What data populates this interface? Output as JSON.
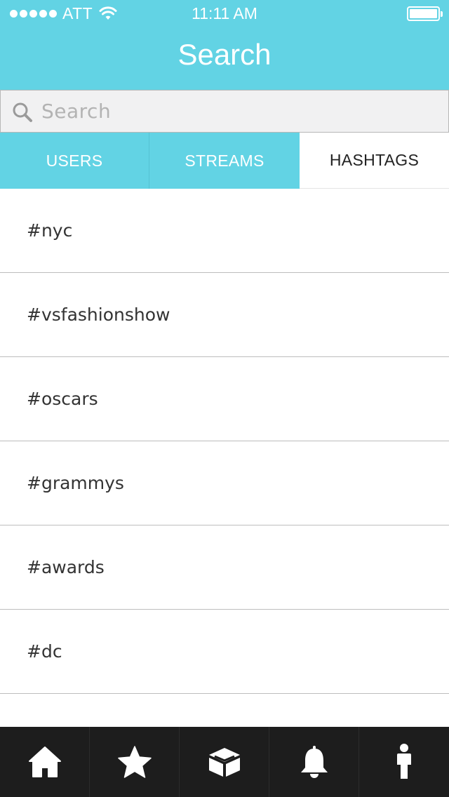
{
  "status_bar": {
    "carrier": "ATT",
    "time": "11:11 AM",
    "signal_bars": 5,
    "battery_level": 1.0
  },
  "header": {
    "title": "Search",
    "background_color": "#62d3e4"
  },
  "search": {
    "placeholder": "Search",
    "value": "",
    "icon": "search-icon"
  },
  "tabs": [
    {
      "label": "USERS",
      "selected": false
    },
    {
      "label": "STREAMS",
      "selected": false
    },
    {
      "label": "HASHTAGS",
      "selected": true
    }
  ],
  "hashtags": [
    {
      "label": "#nyc"
    },
    {
      "label": "#vsfashionshow"
    },
    {
      "label": "#oscars"
    },
    {
      "label": "#grammys"
    },
    {
      "label": "#awards"
    },
    {
      "label": "#dc"
    }
  ],
  "tabbar": {
    "items": [
      {
        "icon": "home-icon"
      },
      {
        "icon": "star-icon"
      },
      {
        "icon": "box-icon"
      },
      {
        "icon": "bell-icon"
      },
      {
        "icon": "person-icon"
      }
    ]
  }
}
